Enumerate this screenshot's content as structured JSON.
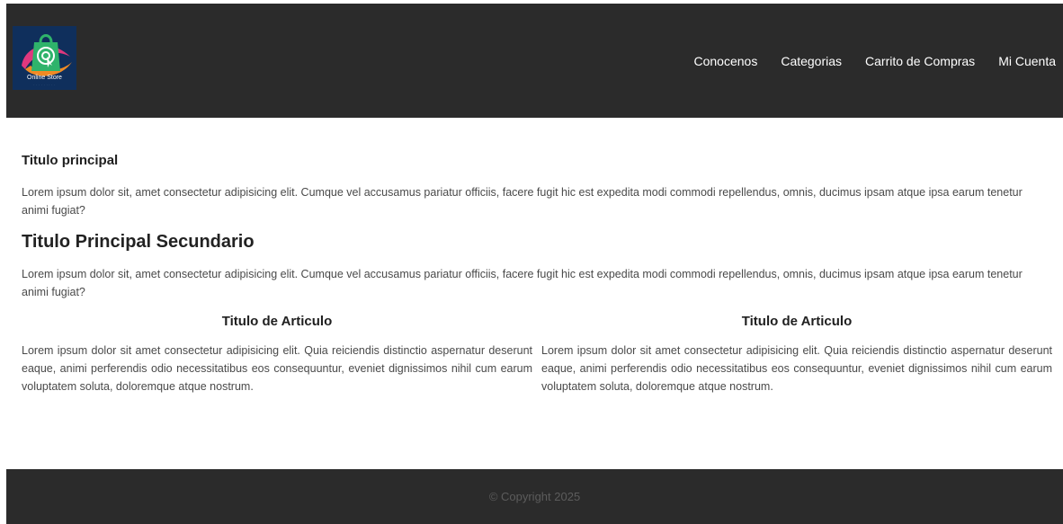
{
  "header": {
    "logo": {
      "text": "Online Store",
      "subtext": "· · · · · · · · ·",
      "colors": {
        "bg": "#0f2f5c",
        "bag": "#2fb36b",
        "ring_orange": "#f08a24",
        "ring_pink": "#e0387e"
      }
    },
    "nav": [
      {
        "label": "Conocenos"
      },
      {
        "label": "Categorias"
      },
      {
        "label": "Carrito de Compras"
      },
      {
        "label": "Mi Cuenta"
      }
    ]
  },
  "main": {
    "title": "Titulo principal",
    "intro": "Lorem ipsum dolor sit, amet consectetur adipisicing elit. Cumque vel accusamus pariatur officiis, facere fugit hic est expedita modi commodi repellendus, omnis, ducimus ipsam atque ipsa earum tenetur animi fugiat?",
    "subtitle": "Titulo Principal Secundario",
    "intro2": "Lorem ipsum dolor sit, amet consectetur adipisicing elit. Cumque vel accusamus pariatur officiis, facere fugit hic est expedita modi commodi repellendus, omnis, ducimus ipsam atque ipsa earum tenetur animi fugiat?",
    "articles": [
      {
        "title": "Titulo de Articulo",
        "body": "Lorem ipsum dolor sit amet consectetur adipisicing elit. Quia reiciendis distinctio aspernatur deserunt eaque, animi perferendis odio necessitatibus eos consequuntur, eveniet dignissimos nihil cum earum voluptatem soluta, doloremque atque nostrum."
      },
      {
        "title": "Titulo de Articulo",
        "body": "Lorem ipsum dolor sit amet consectetur adipisicing elit. Quia reiciendis distinctio aspernatur deserunt eaque, animi perferendis odio necessitatibus eos consequuntur, eveniet dignissimos nihil cum earum voluptatem soluta, doloremque atque nostrum."
      }
    ]
  },
  "footer": {
    "copyright": "© Copyright 2025"
  },
  "colors": {
    "bar": "#2b2b2b",
    "footer_text": "#5c5c5c",
    "body_text": "#4a4a4a"
  }
}
